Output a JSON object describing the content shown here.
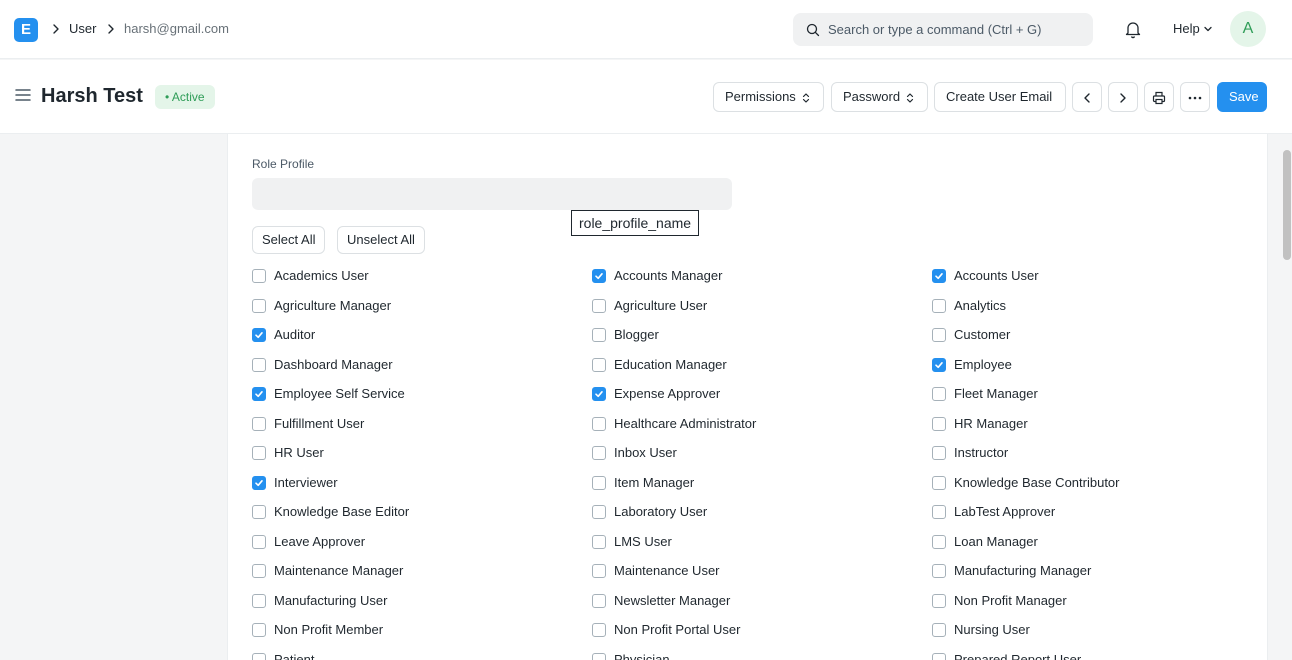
{
  "navbar": {
    "logo_letter": "E",
    "breadcrumbs": [
      "User",
      "harsh@gmail.com"
    ],
    "search_placeholder": "Search or type a command (Ctrl + G)",
    "help_label": "Help",
    "avatar_letter": "A"
  },
  "page": {
    "title": "Harsh Test",
    "status": "Active",
    "buttons": {
      "permissions": "Permissions",
      "password": "Password",
      "create_user_email": "Create User Email",
      "save": "Save"
    }
  },
  "form": {
    "role_profile_label": "Role Profile",
    "role_profile_value": "",
    "tooltip": "role_profile_name",
    "select_all": "Select All",
    "unselect_all": "Unselect All",
    "roles": [
      {
        "label": "Academics User",
        "checked": false
      },
      {
        "label": "Accounts Manager",
        "checked": true
      },
      {
        "label": "Accounts User",
        "checked": true
      },
      {
        "label": "Agriculture Manager",
        "checked": false
      },
      {
        "label": "Agriculture User",
        "checked": false
      },
      {
        "label": "Analytics",
        "checked": false
      },
      {
        "label": "Auditor",
        "checked": true
      },
      {
        "label": "Blogger",
        "checked": false
      },
      {
        "label": "Customer",
        "checked": false
      },
      {
        "label": "Dashboard Manager",
        "checked": false
      },
      {
        "label": "Education Manager",
        "checked": false
      },
      {
        "label": "Employee",
        "checked": true
      },
      {
        "label": "Employee Self Service",
        "checked": true
      },
      {
        "label": "Expense Approver",
        "checked": true
      },
      {
        "label": "Fleet Manager",
        "checked": false
      },
      {
        "label": "Fulfillment User",
        "checked": false
      },
      {
        "label": "Healthcare Administrator",
        "checked": false
      },
      {
        "label": "HR Manager",
        "checked": false
      },
      {
        "label": "HR User",
        "checked": false
      },
      {
        "label": "Inbox User",
        "checked": false
      },
      {
        "label": "Instructor",
        "checked": false
      },
      {
        "label": "Interviewer",
        "checked": true
      },
      {
        "label": "Item Manager",
        "checked": false
      },
      {
        "label": "Knowledge Base Contributor",
        "checked": false
      },
      {
        "label": "Knowledge Base Editor",
        "checked": false
      },
      {
        "label": "Laboratory User",
        "checked": false
      },
      {
        "label": "LabTest Approver",
        "checked": false
      },
      {
        "label": "Leave Approver",
        "checked": false
      },
      {
        "label": "LMS User",
        "checked": false
      },
      {
        "label": "Loan Manager",
        "checked": false
      },
      {
        "label": "Maintenance Manager",
        "checked": false
      },
      {
        "label": "Maintenance User",
        "checked": false
      },
      {
        "label": "Manufacturing Manager",
        "checked": false
      },
      {
        "label": "Manufacturing User",
        "checked": false
      },
      {
        "label": "Newsletter Manager",
        "checked": false
      },
      {
        "label": "Non Profit Manager",
        "checked": false
      },
      {
        "label": "Non Profit Member",
        "checked": false
      },
      {
        "label": "Non Profit Portal User",
        "checked": false
      },
      {
        "label": "Nursing User",
        "checked": false
      },
      {
        "label": "Patient",
        "checked": false
      },
      {
        "label": "Physician",
        "checked": false
      },
      {
        "label": "Prepared Report User",
        "checked": false
      }
    ]
  },
  "colors": {
    "accent": "#2490ef",
    "active_badge_bg": "#e4f5e9",
    "active_badge_text": "#2f9d58"
  },
  "icons": [
    "app-logo-icon",
    "chevron-right-icon",
    "search-icon",
    "bell-icon",
    "chevron-down-icon",
    "hamburger-icon",
    "select-arrows-icon",
    "chevron-left-icon",
    "printer-icon",
    "more-icon",
    "check-icon"
  ]
}
